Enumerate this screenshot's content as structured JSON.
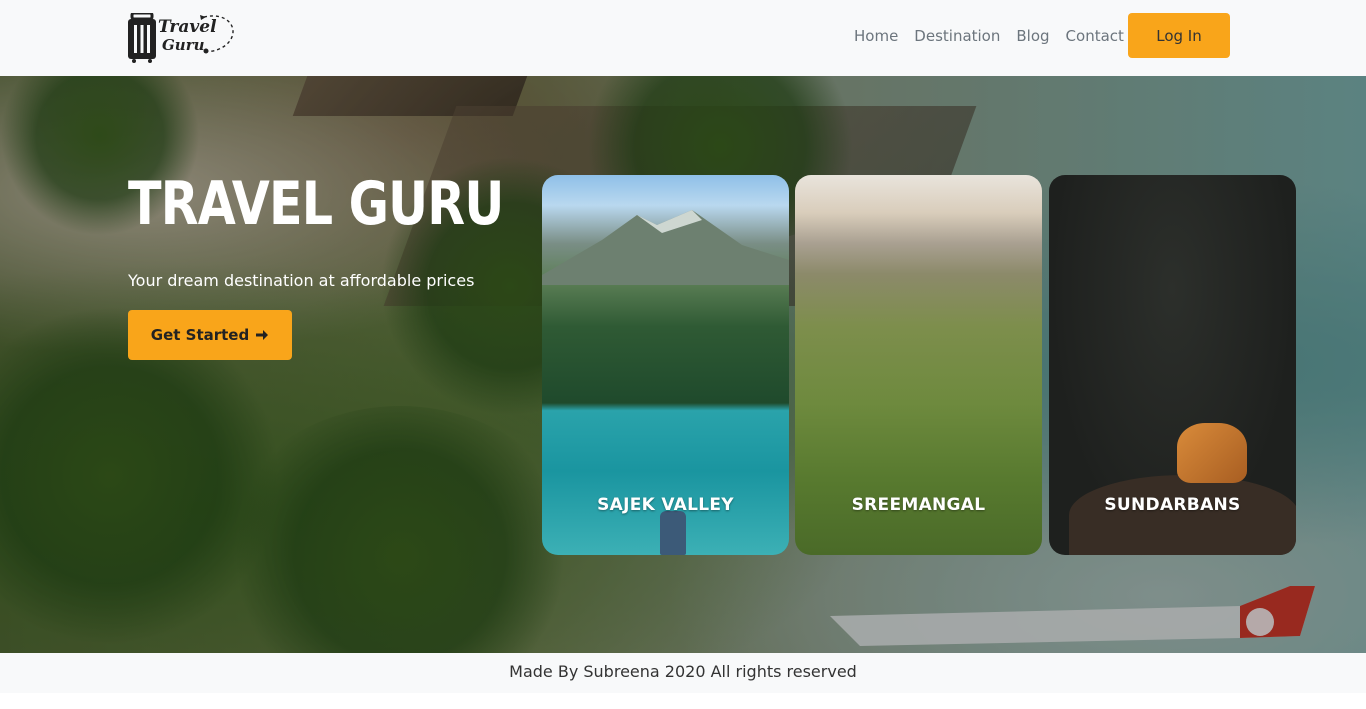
{
  "brand": {
    "logo_line1": "Travel",
    "logo_line2": "Guru"
  },
  "nav": {
    "links": [
      "Home",
      "Destination",
      "Blog",
      "Contact"
    ],
    "login_label": "Log In"
  },
  "hero": {
    "title": "TRAVEL GURU",
    "subtitle": "Your dream destination at affordable prices",
    "cta_label": "Get Started",
    "cta_icon": "arrow-right-icon"
  },
  "destinations": [
    {
      "name": "SAJEK VALLEY"
    },
    {
      "name": "SREEMANGAL"
    },
    {
      "name": "SUNDARBANS"
    }
  ],
  "footer": {
    "text": "Made By Subreena 2020 All rights reserved"
  },
  "colors": {
    "accent": "#f9a51a",
    "navbar_bg": "#f8f9fa",
    "nav_text": "#6c757d"
  }
}
